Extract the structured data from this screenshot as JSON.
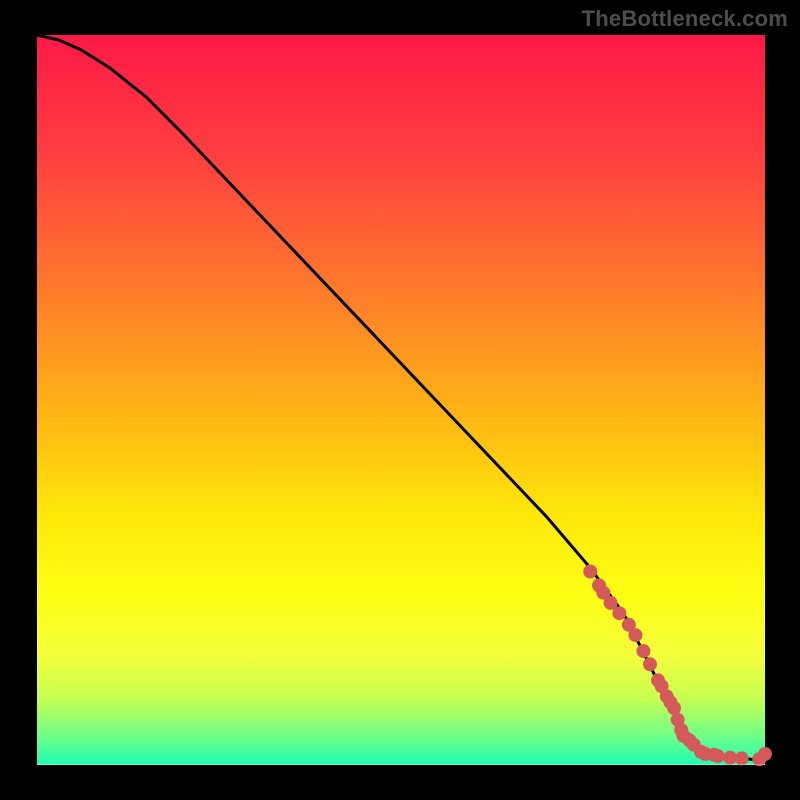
{
  "watermark": "TheBottleneck.com",
  "chart_data": {
    "type": "line",
    "title": "",
    "xlabel": "",
    "ylabel": "",
    "x": [
      0,
      3,
      6,
      10,
      15,
      20,
      30,
      40,
      50,
      60,
      70,
      76,
      80,
      81,
      82,
      83,
      84,
      85,
      86,
      87,
      88,
      89,
      90,
      92,
      94,
      96,
      98,
      100
    ],
    "y": [
      100,
      99.3,
      98.0,
      95.5,
      91.5,
      86.5,
      76.0,
      65.5,
      55.0,
      44.5,
      34.0,
      27.0,
      21.5,
      20.0,
      18.0,
      16.0,
      14.0,
      12.0,
      10.0,
      8.0,
      6.0,
      4.0,
      2.5,
      1.5,
      1.2,
      1.0,
      0.8,
      0.6
    ],
    "xlim": [
      0,
      100
    ],
    "ylim": [
      0,
      100
    ],
    "markers_x": [
      76,
      77.2,
      77.8,
      78.8,
      80.0,
      81.3,
      82.2,
      83.3,
      84.2,
      85.3,
      85.8,
      86.5,
      87.0,
      87.5,
      88.0,
      88.5,
      88.8,
      89.6,
      90.2,
      91.2,
      91.8,
      93.0,
      93.5,
      95.2,
      96.8,
      99.2,
      100
    ],
    "markers_y": [
      26.5,
      24.6,
      23.6,
      22.2,
      20.8,
      19.2,
      17.8,
      15.6,
      13.8,
      11.6,
      10.8,
      9.4,
      8.6,
      7.8,
      6.2,
      4.8,
      4.0,
      3.4,
      2.8,
      1.8,
      1.5,
      1.4,
      1.2,
      1.0,
      0.9,
      0.8,
      1.5
    ]
  },
  "style": {
    "marker_radius": 7,
    "bg_stops": [
      {
        "pct": 0,
        "hex": "#ff1846"
      },
      {
        "pct": 17,
        "hex": "#ff4040"
      },
      {
        "pct": 36,
        "hex": "#ff7e2a"
      },
      {
        "pct": 52,
        "hex": "#ffb514"
      },
      {
        "pct": 66,
        "hex": "#ffe80a"
      },
      {
        "pct": 77,
        "hex": "#feff14"
      },
      {
        "pct": 85,
        "hex": "#f4ff3c"
      },
      {
        "pct": 91,
        "hex": "#c4ff52"
      },
      {
        "pct": 96,
        "hex": "#70ff87"
      },
      {
        "pct": 100,
        "hex": "#1effb4"
      }
    ]
  }
}
